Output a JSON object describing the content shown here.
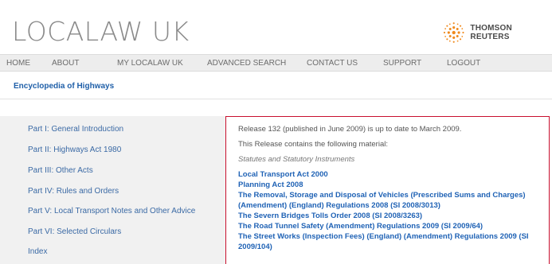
{
  "header": {
    "site_title": "LOCALAW UK",
    "brand_name": "THOMSON REUTERS",
    "brand_icon": "thomson-reuters-logo-icon",
    "brand_color": "#f08a1d"
  },
  "nav": {
    "items": [
      "HOME",
      "ABOUT",
      "MY LOCALAW UK",
      "ADVANCED SEARCH",
      "CONTACT US",
      "SUPPORT",
      "LOGOUT"
    ]
  },
  "page": {
    "subtitle": "Encyclopedia of Highways"
  },
  "sidebar": {
    "items": [
      "Part I: General Introduction",
      "Part II: Highways Act 1980",
      "Part III: Other Acts",
      "Part IV: Rules and Orders",
      "Part V: Local Transport Notes and Other Advice",
      "Part VI: Selected Circulars",
      "Index"
    ]
  },
  "content": {
    "release_line": "Release 132 (published in June 2009) is up to date to March 2009.",
    "intro_line": "This Release contains the following material:",
    "section_heading": "Statutes and Statutory Instruments",
    "items": [
      "Local Transport Act 2000",
      "Planning Act 2008",
      "The Removal, Storage and Disposal of Vehicles (Prescribed Sums and Charges)",
      "(Amendment) (England) Regulations 2008 (SI 2008/3013)",
      "The Severn Bridges Tolls Order 2008 (SI 2008/3263)",
      "The Road Tunnel Safety (Amendment) Regulations 2009 (SI 2009/64)",
      "The Street Works (Inspection Fees) (England) (Amendment) Regulations 2009 (SI",
      "2009/104)"
    ]
  }
}
